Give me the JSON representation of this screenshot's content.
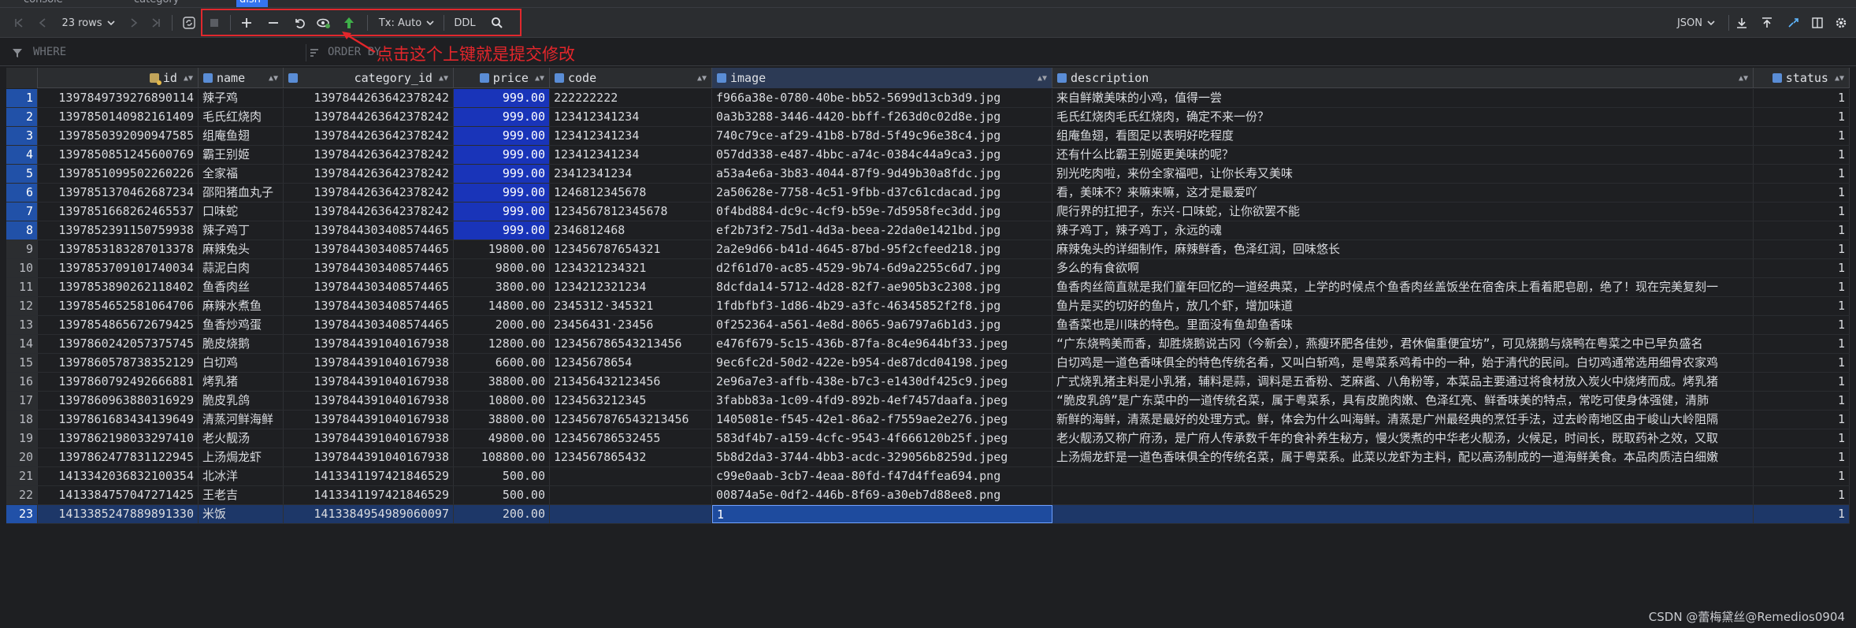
{
  "tabs": [
    {
      "label": "console"
    },
    {
      "label": "category"
    },
    {
      "label": "dish"
    }
  ],
  "toolbar": {
    "rows_label": "23 rows",
    "tx_label": "Tx: Auto",
    "ddl_label": "DDL",
    "format_label": "JSON"
  },
  "filter": {
    "where_placeholder": "WHERE",
    "order_placeholder": "ORDER BY"
  },
  "annotation": "点击这个上键就是提交修改",
  "columns": [
    "id",
    "name",
    "category_id",
    "price",
    "code",
    "image",
    "description",
    "status"
  ],
  "rows": [
    {
      "n": "1",
      "id": "1397849739276890114",
      "name": "辣子鸡",
      "category_id": "1397844263642378242",
      "price": "999.00",
      "code": "222222222",
      "image": "f966a38e-0780-40be-bb52-5699d13cb3d9.jpg",
      "description": "来自鲜嫩美味的小鸡，值得一尝",
      "status": "1"
    },
    {
      "n": "2",
      "id": "1397850140982161409",
      "name": "毛氏红烧肉",
      "category_id": "1397844263642378242",
      "price": "999.00",
      "code": "123412341234",
      "image": "0a3b3288-3446-4420-bbff-f263d0c02d8e.jpg",
      "description": "毛氏红烧肉毛氏红烧肉，确定不来一份？",
      "status": "1"
    },
    {
      "n": "3",
      "id": "1397850392090947585",
      "name": "组庵鱼翅",
      "category_id": "1397844263642378242",
      "price": "999.00",
      "code": "123412341234",
      "image": "740c79ce-af29-41b8-b78d-5f49c96e38c4.jpg",
      "description": "组庵鱼翅，看图足以表明好吃程度",
      "status": "1"
    },
    {
      "n": "4",
      "id": "1397850851245600769",
      "name": "霸王别姬",
      "category_id": "1397844263642378242",
      "price": "999.00",
      "code": "123412341234",
      "image": "057dd338-e487-4bbc-a74c-0384c44a9ca3.jpg",
      "description": "还有什么比霸王别姬更美味的呢？",
      "status": "1"
    },
    {
      "n": "5",
      "id": "1397851099502260226",
      "name": "全家福",
      "category_id": "1397844263642378242",
      "price": "999.00",
      "code": "23412341234",
      "image": "a53a4e6a-3b83-4044-87f9-9d49b30a8fdc.jpg",
      "description": "别光吃肉啦，来份全家福吧，让你长寿又美味",
      "status": "1"
    },
    {
      "n": "6",
      "id": "1397851370462687234",
      "name": "邵阳猪血丸子",
      "category_id": "1397844263642378242",
      "price": "999.00",
      "code": "1246812345678",
      "image": "2a50628e-7758-4c51-9fbb-d37c61cdacad.jpg",
      "description": "看，美味不？来嘛来嘛，这才是最爱吖",
      "status": "1"
    },
    {
      "n": "7",
      "id": "1397851668262465537",
      "name": "口味蛇",
      "category_id": "1397844263642378242",
      "price": "999.00",
      "code": "1234567812345678",
      "image": "0f4bd884-dc9c-4cf9-b59e-7d5958fec3dd.jpg",
      "description": "爬行界的扛把子，东兴-口味蛇，让你欲罢不能",
      "status": "1"
    },
    {
      "n": "8",
      "id": "1397852391150759938",
      "name": "辣子鸡丁",
      "category_id": "1397844303408574465",
      "price": "999.00",
      "code": "2346812468",
      "image": "ef2b73f2-75d1-4d3a-beea-22da0e1421bd.jpg",
      "description": "辣子鸡丁，辣子鸡丁，永远的魂",
      "status": "1"
    },
    {
      "n": "9",
      "id": "1397853183287013378",
      "name": "麻辣兔头",
      "category_id": "1397844303408574465",
      "price": "19800.00",
      "code": "123456787654321",
      "image": "2a2e9d66-b41d-4645-87bd-95f2cfeed218.jpg",
      "description": "麻辣兔头的详细制作，麻辣鲜香，色泽红润，回味悠长",
      "status": "1"
    },
    {
      "n": "10",
      "id": "1397853709101740034",
      "name": "蒜泥白肉",
      "category_id": "1397844303408574465",
      "price": "9800.00",
      "code": "1234321234321",
      "image": "d2f61d70-ac85-4529-9b74-6d9a2255c6d7.jpg",
      "description": "多么的有食欲啊",
      "status": "1"
    },
    {
      "n": "11",
      "id": "1397853890262118402",
      "name": "鱼香肉丝",
      "category_id": "1397844303408574465",
      "price": "3800.00",
      "code": "1234212321234",
      "image": "8dcfda14-5712-4d28-82f7-ae905b3c2308.jpg",
      "description": "鱼香肉丝简直就是我们童年回忆的一道经典菜，上学的时候点个鱼香肉丝盖饭坐在宿舍床上看着肥皂剧，绝了！现在完美复刻一",
      "status": "1"
    },
    {
      "n": "12",
      "id": "1397854652581064706",
      "name": "麻辣水煮鱼",
      "category_id": "1397844303408574465",
      "price": "14800.00",
      "code": "2345312·345321",
      "image": "1fdbfbf3-1d86-4b29-a3fc-46345852f2f8.jpg",
      "description": "鱼片是买的切好的鱼片，放几个虾，增加味道",
      "status": "1"
    },
    {
      "n": "13",
      "id": "1397854865672679425",
      "name": "鱼香炒鸡蛋",
      "category_id": "1397844303408574465",
      "price": "2000.00",
      "code": "23456431·23456",
      "image": "0f252364-a561-4e8d-8065-9a6797a6b1d3.jpg",
      "description": "鱼香菜也是川味的特色。里面没有鱼却鱼香味",
      "status": "1"
    },
    {
      "n": "14",
      "id": "1397860242057375745",
      "name": "脆皮烧鹅",
      "category_id": "1397844391040167938",
      "price": "12800.00",
      "code": "123456786543213456",
      "image": "e476f679-5c15-436b-87fa-8c4e9644bf33.jpeg",
      "description": "“广东烧鸭美而香，却胜烧鹅说古冈（今新会），燕瘦环肥各佳妙，君休偏重便宜坊”，可见烧鹅与烧鸭在粤菜之中已早负盛名",
      "status": "1"
    },
    {
      "n": "15",
      "id": "1397860578738352129",
      "name": "白切鸡",
      "category_id": "1397844391040167938",
      "price": "6600.00",
      "code": "12345678654",
      "image": "9ec6fc2d-50d2-422e-b954-de87dcd04198.jpeg",
      "description": "白切鸡是一道色香味俱全的特色传统名肴，又叫白斩鸡，是粤菜系鸡肴中的一种，始于清代的民间。白切鸡通常选用细骨农家鸡",
      "status": "1"
    },
    {
      "n": "16",
      "id": "1397860792492666881",
      "name": "烤乳猪",
      "category_id": "1397844391040167938",
      "price": "38800.00",
      "code": "213456432123456",
      "image": "2e96a7e3-affb-438e-b7c3-e1430df425c9.jpeg",
      "description": "广式烧乳猪主料是小乳猪，辅料是蒜，调料是五香粉、芝麻酱、八角粉等，本菜品主要通过将食材放入炭火中烧烤而成。烤乳猪",
      "status": "1"
    },
    {
      "n": "17",
      "id": "1397860963880316929",
      "name": "脆皮乳鸽",
      "category_id": "1397844391040167938",
      "price": "10800.00",
      "code": "1234563212345",
      "image": "3fabb83a-1c09-4fd9-892b-4ef7457daafa.jpeg",
      "description": "“脆皮乳鸽”是广东菜中的一道传统名菜，属于粤菜系，具有皮脆肉嫩、色泽红亮、鲜香味美的特点，常吃可使身体强健，清肺",
      "status": "1"
    },
    {
      "n": "18",
      "id": "1397861683434139649",
      "name": "清蒸河鲜海鲜",
      "category_id": "1397844391040167938",
      "price": "38800.00",
      "code": "1234567876543213456",
      "image": "1405081e-f545-42e1-86a2-f7559ae2e276.jpeg",
      "description": "新鲜的海鲜，清蒸是最好的处理方式。鲜，体会为什么叫海鲜。清蒸是广州最经典的烹饪手法，过去岭南地区由于峻山大岭阻隔",
      "status": "1"
    },
    {
      "n": "19",
      "id": "1397862198033297410",
      "name": "老火靓汤",
      "category_id": "1397844391040167938",
      "price": "49800.00",
      "code": "123456786532455",
      "image": "583df4b7-a159-4cfc-9543-4f666120b25f.jpeg",
      "description": "老火靓汤又称广府汤，是广府人传承数千年的食补养生秘方，慢火煲煮的中华老火靓汤，火候足，时间长，既取药补之效，又取",
      "status": "1"
    },
    {
      "n": "20",
      "id": "1397862477831122945",
      "name": "上汤焗龙虾",
      "category_id": "1397844391040167938",
      "price": "108800.00",
      "code": "1234567865432",
      "image": "5b8d2da3-3744-4bb3-acdc-329056b8259d.jpeg",
      "description": "上汤焗龙虾是一道色香味俱全的传统名菜，属于粤菜系。此菜以龙虾为主料，配以高汤制成的一道海鲜美食。本品肉质洁白细嫩",
      "status": "1"
    },
    {
      "n": "21",
      "id": "1413342036832100354",
      "name": "北冰洋",
      "category_id": "1413341197421846529",
      "price": "500.00",
      "code": "",
      "image": "c99e0aab-3cb7-4eaa-80fd-f47d4ffea694.png",
      "description": "",
      "status": "1"
    },
    {
      "n": "22",
      "id": "1413384757047271425",
      "name": "王老吉",
      "category_id": "1413341197421846529",
      "price": "500.00",
      "code": "",
      "image": "00874a5e-0df2-446b-8f69-a30eb7d88ee8.png",
      "description": "",
      "status": "1"
    },
    {
      "n": "23",
      "id": "1413385247889891330",
      "name": "米饭",
      "category_id": "1413384954989060097",
      "price": "200.00",
      "code": "",
      "image": "1",
      "description": "",
      "status": "1"
    }
  ],
  "watermark": "CSDN @蕾梅黛丝@Remedios0904"
}
